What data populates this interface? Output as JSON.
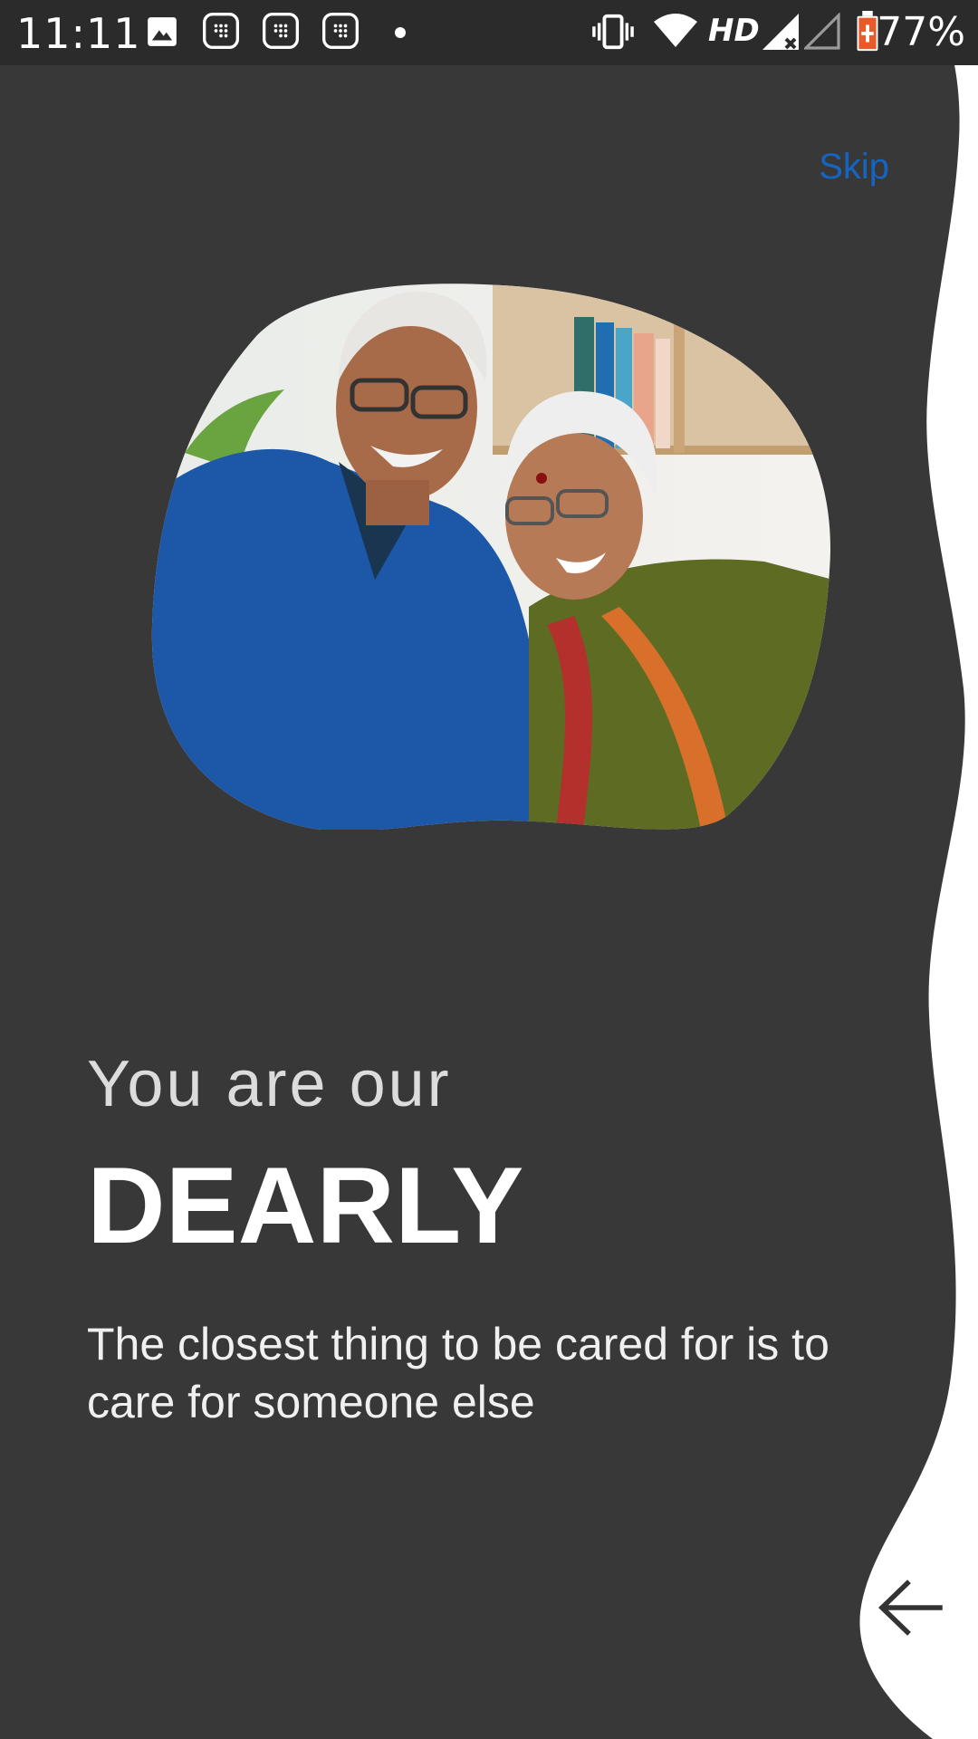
{
  "status_bar": {
    "time": "11:11",
    "network": "HD",
    "battery": "77%",
    "icons": [
      "image-icon",
      "app-icon",
      "app-icon",
      "app-icon",
      "dot-icon",
      "vibrate-icon",
      "wifi-icon",
      "signal-icon",
      "signal-empty-icon",
      "battery-charging-icon"
    ]
  },
  "onboarding": {
    "skip_label": "Skip",
    "headline_small": "You are our",
    "headline_big": "DEARLY",
    "subtitle": "The closest thing to be cared for is to care for someone else",
    "next_icon": "arrow-left-icon"
  },
  "colors": {
    "background": "#383838",
    "accent_wave": "#ffffff",
    "skip_link": "#1565c0"
  }
}
